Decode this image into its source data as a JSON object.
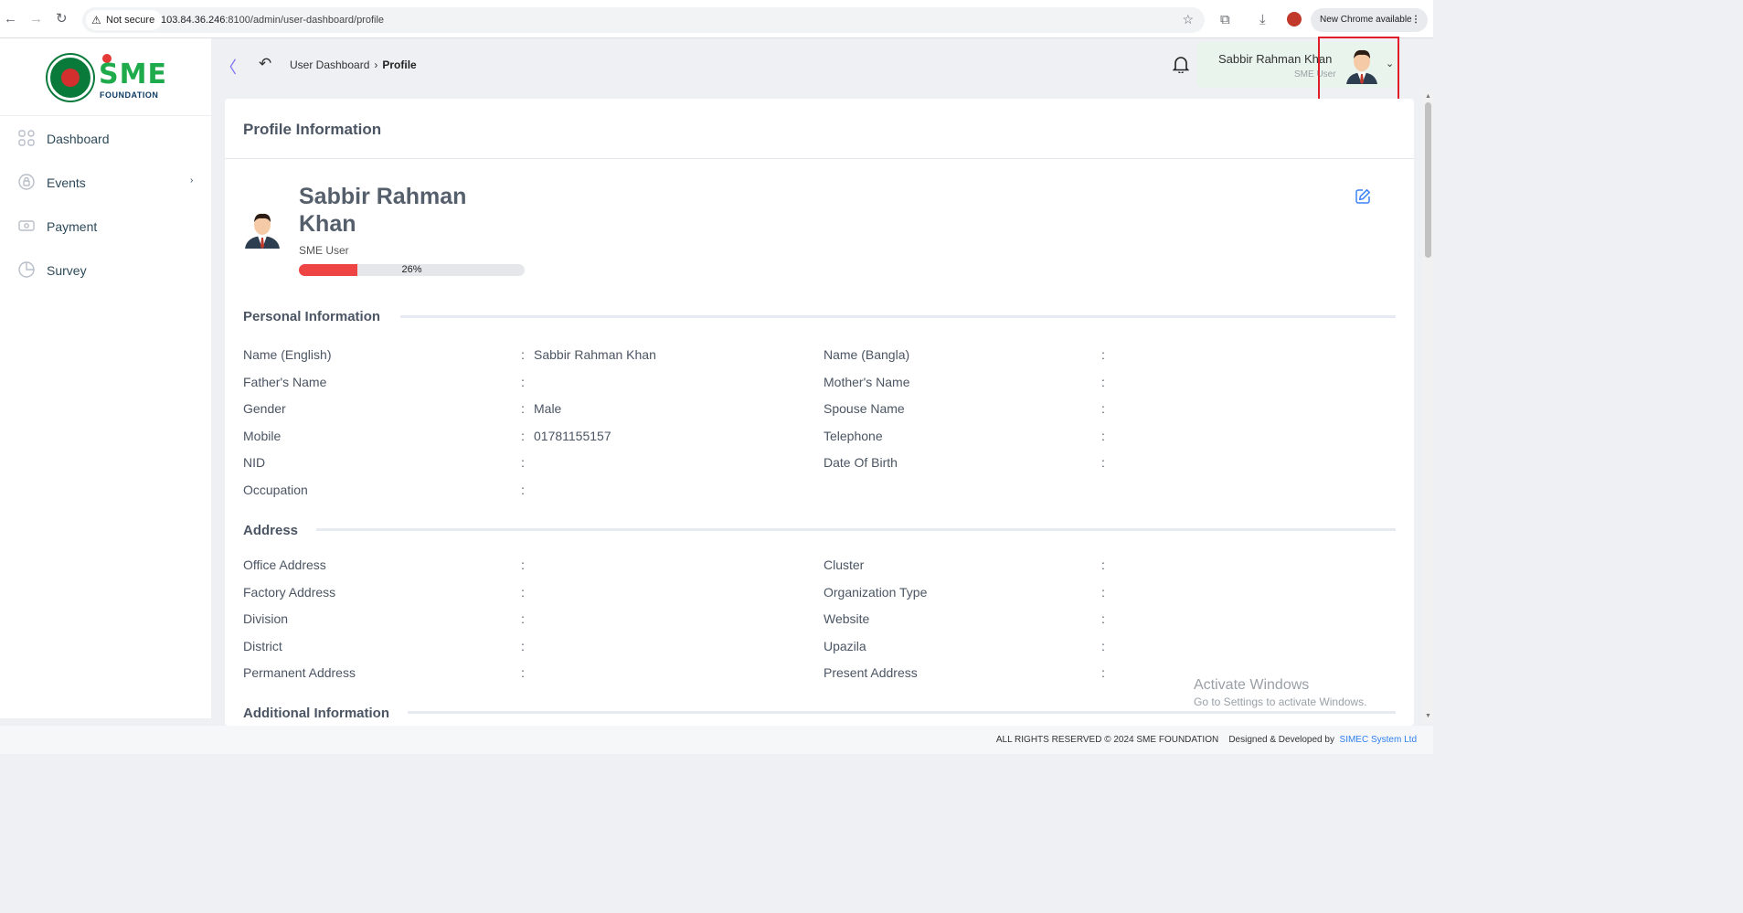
{
  "browser": {
    "security": "Not secure",
    "url_host": "103.84.36.246",
    "url_rest": ":8100/admin/user-dashboard/profile",
    "update_label": "New Chrome available"
  },
  "logo": {
    "brand": "SME",
    "sub": "FOUNDATION"
  },
  "sidebar": {
    "items": [
      {
        "label": "Dashboard",
        "icon": "grid-icon"
      },
      {
        "label": "Events",
        "icon": "lock-icon",
        "has_submenu": true
      },
      {
        "label": "Payment",
        "icon": "cash-icon"
      },
      {
        "label": "Survey",
        "icon": "pie-icon"
      }
    ]
  },
  "header": {
    "breadcrumb": [
      "User Dashboard",
      "Profile"
    ],
    "user_name": "Sabbir Rahman Khan",
    "user_role": "SME User"
  },
  "profile": {
    "section_title": "Profile Information",
    "name_line1": "Sabbir Rahman",
    "name_line2": "Khan",
    "role": "SME User",
    "completion_percent": 26,
    "completion_label": "26%"
  },
  "personal": {
    "title": "Personal Information",
    "rows": [
      {
        "l1": "Name (English)",
        "v1": "Sabbir Rahman Khan",
        "l2": "Name (Bangla)",
        "v2": ""
      },
      {
        "l1": "Father's Name",
        "v1": "",
        "l2": "Mother's Name",
        "v2": ""
      },
      {
        "l1": "Gender",
        "v1": "Male",
        "l2": "Spouse Name",
        "v2": ""
      },
      {
        "l1": "Mobile",
        "v1": "01781155157",
        "l2": "Telephone",
        "v2": ""
      },
      {
        "l1": "NID",
        "v1": "",
        "l2": "Date Of Birth",
        "v2": ""
      },
      {
        "l1": "Occupation",
        "v1": "",
        "l2": "",
        "v2": ""
      }
    ]
  },
  "address": {
    "title": "Address",
    "rows": [
      {
        "l1": "Office Address",
        "v1": "",
        "l2": "Cluster",
        "v2": ""
      },
      {
        "l1": "Factory Address",
        "v1": "",
        "l2": "Organization Type",
        "v2": ""
      },
      {
        "l1": "Division",
        "v1": "",
        "l2": "Website",
        "v2": ""
      },
      {
        "l1": "District",
        "v1": "",
        "l2": "Upazila",
        "v2": ""
      },
      {
        "l1": "Permanent Address",
        "v1": "",
        "l2": "Present Address",
        "v2": ""
      }
    ]
  },
  "additional": {
    "title": "Additional Information"
  },
  "colon": ":",
  "watermark": {
    "line1": "Activate Windows",
    "line2": "Go to Settings to activate Windows."
  },
  "footer": {
    "rights": "ALL RIGHTS RESERVED © 2024 SME FOUNDATION",
    "designed": "Designed & Developed by",
    "company": "SIMEC System Ltd"
  },
  "colors": {
    "accent_green": "#1faa4b",
    "progress_red": "#ef4444",
    "highlight_box": "#e11d2a",
    "edit_blue": "#3b82f6"
  }
}
